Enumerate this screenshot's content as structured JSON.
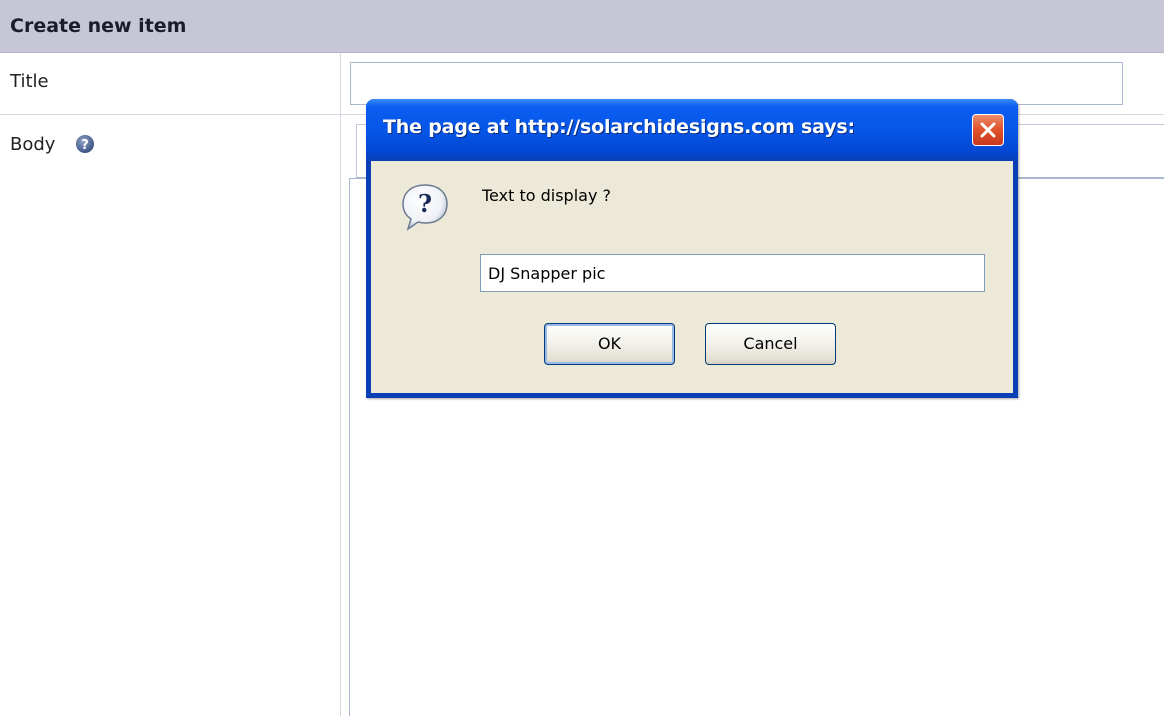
{
  "page": {
    "header_title": "Create new item",
    "title_label": "Title",
    "body_label": "Body",
    "title_input_value": ""
  },
  "dialog": {
    "title": "The page at http://solarchidesigns.com says:",
    "prompt": "Text to display ?",
    "input_value": "DJ Snapper pic",
    "ok_label": "OK",
    "cancel_label": "Cancel"
  },
  "icons": {
    "help": "question-circle-icon",
    "close": "close-x-icon",
    "dialog": "question-bubble-icon"
  },
  "colors": {
    "header_bg": "#c6c6d6",
    "titlebar_blue": "#0656e8",
    "dialog_client": "#ece9d8",
    "close_red": "#e0542d",
    "input_border": "#a9b8d0"
  }
}
